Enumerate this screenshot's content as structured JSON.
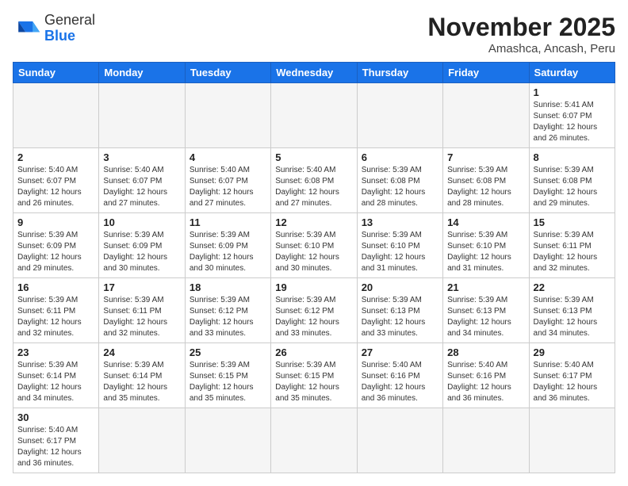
{
  "header": {
    "logo_general": "General",
    "logo_blue": "Blue",
    "month_year": "November 2025",
    "location": "Amashca, Ancash, Peru"
  },
  "days_of_week": [
    "Sunday",
    "Monday",
    "Tuesday",
    "Wednesday",
    "Thursday",
    "Friday",
    "Saturday"
  ],
  "weeks": [
    [
      {
        "day": "",
        "info": "",
        "empty": true
      },
      {
        "day": "",
        "info": "",
        "empty": true
      },
      {
        "day": "",
        "info": "",
        "empty": true
      },
      {
        "day": "",
        "info": "",
        "empty": true
      },
      {
        "day": "",
        "info": "",
        "empty": true
      },
      {
        "day": "",
        "info": "",
        "empty": true
      },
      {
        "day": "1",
        "info": "Sunrise: 5:41 AM\nSunset: 6:07 PM\nDaylight: 12 hours and 26 minutes.",
        "empty": false
      }
    ],
    [
      {
        "day": "2",
        "info": "Sunrise: 5:40 AM\nSunset: 6:07 PM\nDaylight: 12 hours and 26 minutes.",
        "empty": false
      },
      {
        "day": "3",
        "info": "Sunrise: 5:40 AM\nSunset: 6:07 PM\nDaylight: 12 hours and 27 minutes.",
        "empty": false
      },
      {
        "day": "4",
        "info": "Sunrise: 5:40 AM\nSunset: 6:07 PM\nDaylight: 12 hours and 27 minutes.",
        "empty": false
      },
      {
        "day": "5",
        "info": "Sunrise: 5:40 AM\nSunset: 6:08 PM\nDaylight: 12 hours and 27 minutes.",
        "empty": false
      },
      {
        "day": "6",
        "info": "Sunrise: 5:39 AM\nSunset: 6:08 PM\nDaylight: 12 hours and 28 minutes.",
        "empty": false
      },
      {
        "day": "7",
        "info": "Sunrise: 5:39 AM\nSunset: 6:08 PM\nDaylight: 12 hours and 28 minutes.",
        "empty": false
      },
      {
        "day": "8",
        "info": "Sunrise: 5:39 AM\nSunset: 6:08 PM\nDaylight: 12 hours and 29 minutes.",
        "empty": false
      }
    ],
    [
      {
        "day": "9",
        "info": "Sunrise: 5:39 AM\nSunset: 6:09 PM\nDaylight: 12 hours and 29 minutes.",
        "empty": false
      },
      {
        "day": "10",
        "info": "Sunrise: 5:39 AM\nSunset: 6:09 PM\nDaylight: 12 hours and 30 minutes.",
        "empty": false
      },
      {
        "day": "11",
        "info": "Sunrise: 5:39 AM\nSunset: 6:09 PM\nDaylight: 12 hours and 30 minutes.",
        "empty": false
      },
      {
        "day": "12",
        "info": "Sunrise: 5:39 AM\nSunset: 6:10 PM\nDaylight: 12 hours and 30 minutes.",
        "empty": false
      },
      {
        "day": "13",
        "info": "Sunrise: 5:39 AM\nSunset: 6:10 PM\nDaylight: 12 hours and 31 minutes.",
        "empty": false
      },
      {
        "day": "14",
        "info": "Sunrise: 5:39 AM\nSunset: 6:10 PM\nDaylight: 12 hours and 31 minutes.",
        "empty": false
      },
      {
        "day": "15",
        "info": "Sunrise: 5:39 AM\nSunset: 6:11 PM\nDaylight: 12 hours and 32 minutes.",
        "empty": false
      }
    ],
    [
      {
        "day": "16",
        "info": "Sunrise: 5:39 AM\nSunset: 6:11 PM\nDaylight: 12 hours and 32 minutes.",
        "empty": false
      },
      {
        "day": "17",
        "info": "Sunrise: 5:39 AM\nSunset: 6:11 PM\nDaylight: 12 hours and 32 minutes.",
        "empty": false
      },
      {
        "day": "18",
        "info": "Sunrise: 5:39 AM\nSunset: 6:12 PM\nDaylight: 12 hours and 33 minutes.",
        "empty": false
      },
      {
        "day": "19",
        "info": "Sunrise: 5:39 AM\nSunset: 6:12 PM\nDaylight: 12 hours and 33 minutes.",
        "empty": false
      },
      {
        "day": "20",
        "info": "Sunrise: 5:39 AM\nSunset: 6:13 PM\nDaylight: 12 hours and 33 minutes.",
        "empty": false
      },
      {
        "day": "21",
        "info": "Sunrise: 5:39 AM\nSunset: 6:13 PM\nDaylight: 12 hours and 34 minutes.",
        "empty": false
      },
      {
        "day": "22",
        "info": "Sunrise: 5:39 AM\nSunset: 6:13 PM\nDaylight: 12 hours and 34 minutes.",
        "empty": false
      }
    ],
    [
      {
        "day": "23",
        "info": "Sunrise: 5:39 AM\nSunset: 6:14 PM\nDaylight: 12 hours and 34 minutes.",
        "empty": false
      },
      {
        "day": "24",
        "info": "Sunrise: 5:39 AM\nSunset: 6:14 PM\nDaylight: 12 hours and 35 minutes.",
        "empty": false
      },
      {
        "day": "25",
        "info": "Sunrise: 5:39 AM\nSunset: 6:15 PM\nDaylight: 12 hours and 35 minutes.",
        "empty": false
      },
      {
        "day": "26",
        "info": "Sunrise: 5:39 AM\nSunset: 6:15 PM\nDaylight: 12 hours and 35 minutes.",
        "empty": false
      },
      {
        "day": "27",
        "info": "Sunrise: 5:40 AM\nSunset: 6:16 PM\nDaylight: 12 hours and 36 minutes.",
        "empty": false
      },
      {
        "day": "28",
        "info": "Sunrise: 5:40 AM\nSunset: 6:16 PM\nDaylight: 12 hours and 36 minutes.",
        "empty": false
      },
      {
        "day": "29",
        "info": "Sunrise: 5:40 AM\nSunset: 6:17 PM\nDaylight: 12 hours and 36 minutes.",
        "empty": false
      }
    ],
    [
      {
        "day": "30",
        "info": "Sunrise: 5:40 AM\nSunset: 6:17 PM\nDaylight: 12 hours and 36 minutes.",
        "empty": false
      },
      {
        "day": "",
        "info": "",
        "empty": true
      },
      {
        "day": "",
        "info": "",
        "empty": true
      },
      {
        "day": "",
        "info": "",
        "empty": true
      },
      {
        "day": "",
        "info": "",
        "empty": true
      },
      {
        "day": "",
        "info": "",
        "empty": true
      },
      {
        "day": "",
        "info": "",
        "empty": true
      }
    ]
  ]
}
